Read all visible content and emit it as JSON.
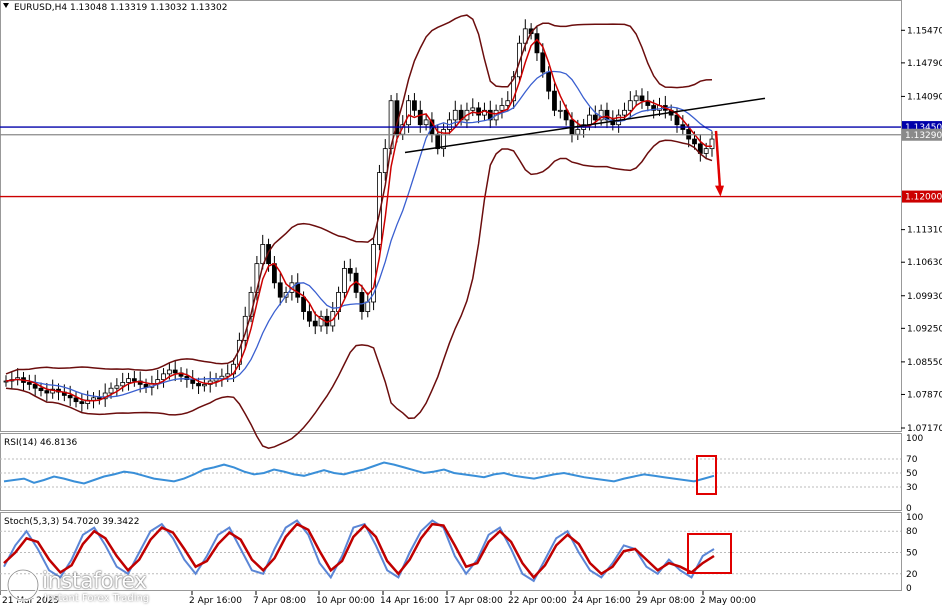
{
  "header": {
    "title": "EURUSD,H4  1.13048 1.13319 1.13032 1.13302",
    "dropdown_icon": "triangle-down-icon"
  },
  "colors": {
    "candle": "#000000",
    "bollinger": "#6b0d0d",
    "ma_fast": "#cc0000",
    "ma_slow": "#3a5fd0",
    "trendline": "#000000",
    "line_blue": "#0000aa",
    "line_red": "#cc0000",
    "line_grey": "#8a8a8a",
    "rsi": "#3a8fd8",
    "stoch_main": "#5b86d6",
    "stoch_signal": "#c00000",
    "highlight": "#e00000"
  },
  "chart_data": [
    {
      "type": "candlestick",
      "symbol": "EURUSD",
      "timeframe": "H4",
      "ohlc_last": {
        "open": 1.13048,
        "high": 1.13319,
        "low": 1.13032,
        "close": 1.13302
      },
      "y_ticks": [
        "1.15470",
        "1.14790",
        "1.14090",
        "1.13290",
        "1.12000",
        "1.11310",
        "1.10630",
        "1.09930",
        "1.09250",
        "1.08550",
        "1.07870",
        "1.07170"
      ],
      "ylim": [
        1.0717,
        1.1581
      ],
      "horizontal_lines": [
        {
          "value": 1.1345,
          "label": "1.13450",
          "color": "#0000aa"
        },
        {
          "value": 1.1329,
          "label": "1.13290",
          "color": "#8a8a8a"
        },
        {
          "value": 1.12,
          "label": "1.12000",
          "color": "#cc0000"
        }
      ],
      "x_ticks": [
        "21 Mar 2025",
        "2 Apr 16:00",
        "7 Apr 08:00",
        "10 Apr 00:00",
        "14 Apr 16:00",
        "17 Apr 08:00",
        "22 Apr 00:00",
        "24 Apr 16:00",
        "29 Apr 08:00",
        "2 May 00:00"
      ],
      "close_series": [
        1.0815,
        1.0818,
        1.0822,
        1.0812,
        1.0808,
        1.08,
        1.0795,
        1.079,
        1.0798,
        1.0792,
        1.0785,
        1.078,
        1.0772,
        1.0768,
        1.0775,
        1.078,
        1.0778,
        1.079,
        1.08,
        1.0805,
        1.0812,
        1.082,
        1.0815,
        1.0808,
        1.0802,
        1.081,
        1.0818,
        1.083,
        1.0838,
        1.0832,
        1.0825,
        1.0818,
        1.081,
        1.0805,
        1.0808,
        1.0815,
        1.082,
        1.0825,
        1.083,
        1.085,
        1.09,
        1.095,
        1.1,
        1.106,
        1.11,
        1.106,
        1.102,
        1.099,
        1.1,
        1.102,
        1.099,
        1.096,
        1.094,
        1.093,
        1.095,
        1.093,
        1.096,
        1.1,
        1.105,
        1.104,
        1.1,
        1.096,
        1.098,
        1.11,
        1.125,
        1.13,
        1.14,
        1.133,
        1.135,
        1.14,
        1.138,
        1.135,
        1.136,
        1.133,
        1.13,
        1.134,
        1.136,
        1.138,
        1.136,
        1.138,
        1.1385,
        1.137,
        1.138,
        1.136,
        1.138,
        1.139,
        1.14,
        1.145,
        1.152,
        1.155,
        1.154,
        1.15,
        1.146,
        1.142,
        1.138,
        1.138,
        1.136,
        1.133,
        1.134,
        1.135,
        1.137,
        1.136,
        1.138,
        1.136,
        1.135,
        1.137,
        1.138,
        1.14,
        1.141,
        1.14,
        1.139,
        1.138,
        1.139,
        1.138,
        1.137,
        1.135,
        1.134,
        1.132,
        1.131,
        1.129,
        1.13,
        1.132
      ],
      "arrow_target": 1.12
    },
    {
      "type": "line",
      "name": "RSI(14)",
      "header": "RSI(14) 46.8136",
      "value": 46.8136,
      "ylim": [
        0,
        100
      ],
      "y_ticks": [
        "100",
        "70",
        "50",
        "30",
        "0"
      ],
      "values": [
        38,
        40,
        42,
        36,
        40,
        45,
        42,
        38,
        35,
        40,
        45,
        48,
        52,
        50,
        46,
        42,
        40,
        38,
        42,
        48,
        55,
        58,
        62,
        58,
        52,
        48,
        50,
        55,
        52,
        48,
        46,
        50,
        54,
        50,
        48,
        52,
        55,
        60,
        65,
        62,
        58,
        54,
        50,
        52,
        55,
        50,
        48,
        46,
        44,
        48,
        50,
        46,
        44,
        42,
        45,
        48,
        50,
        47,
        44,
        42,
        40,
        38,
        42,
        45,
        48,
        46,
        44,
        42,
        40,
        38,
        42,
        46
      ]
    },
    {
      "type": "line",
      "name": "Stoch(5,3,3)",
      "header": "Stoch(5,3,3) 54.7020 39.3422",
      "main_value": 54.702,
      "signal_value": 39.3422,
      "ylim": [
        0,
        100
      ],
      "y_ticks": [
        "100",
        "80",
        "50",
        "20",
        "0"
      ],
      "main": [
        30,
        60,
        80,
        55,
        25,
        15,
        40,
        75,
        85,
        60,
        30,
        20,
        50,
        80,
        90,
        70,
        40,
        20,
        45,
        75,
        85,
        55,
        25,
        20,
        55,
        85,
        95,
        75,
        35,
        15,
        45,
        85,
        90,
        60,
        25,
        15,
        50,
        80,
        95,
        85,
        45,
        20,
        40,
        75,
        85,
        55,
        20,
        10,
        40,
        70,
        80,
        50,
        25,
        15,
        35,
        60,
        55,
        30,
        20,
        40,
        25,
        15,
        45,
        55
      ],
      "signal": [
        35,
        50,
        70,
        65,
        40,
        22,
        32,
        62,
        80,
        70,
        45,
        25,
        40,
        68,
        85,
        78,
        55,
        30,
        38,
        62,
        78,
        68,
        40,
        25,
        42,
        72,
        90,
        82,
        52,
        25,
        38,
        72,
        88,
        72,
        38,
        20,
        40,
        70,
        90,
        88,
        60,
        30,
        35,
        65,
        80,
        65,
        35,
        15,
        32,
        60,
        75,
        62,
        35,
        20,
        30,
        52,
        55,
        40,
        25,
        35,
        30,
        22,
        35,
        45
      ]
    }
  ],
  "branding": {
    "name": "instaforex",
    "tagline": "Instant Forex Trading",
    "icon": "instaforex-logo-icon"
  }
}
